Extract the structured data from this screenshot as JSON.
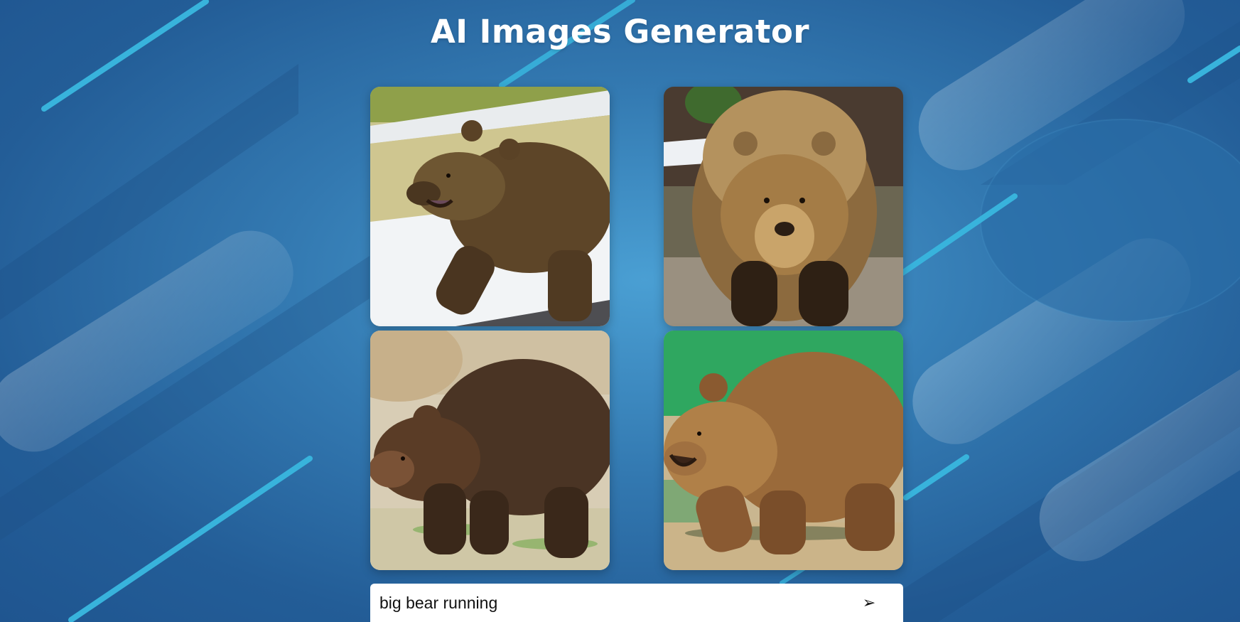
{
  "header": {
    "title": "AI Images Generator"
  },
  "gallery": {
    "images": [
      {
        "subject": "bear-walking-left-snow"
      },
      {
        "subject": "bear-facing-front"
      },
      {
        "subject": "bear-walking-left-dark"
      },
      {
        "subject": "bear-walking-left-light"
      }
    ]
  },
  "prompt": {
    "value": "big bear running",
    "send_icon": "send-icon",
    "send_glyph": "➢"
  },
  "colors": {
    "background": "#2f73ad",
    "accent_line": "#38b3dc",
    "input_bg": "#ffffff"
  }
}
